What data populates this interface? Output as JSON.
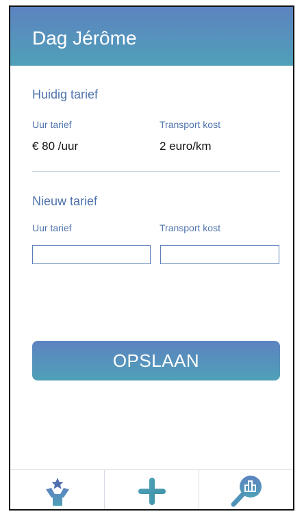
{
  "header": {
    "title": "Dag Jérôme"
  },
  "current": {
    "title": "Huidig tarief",
    "hourly_label": "Uur tarief",
    "hourly_value": "€ 80 /uur",
    "transport_label": "Transport kost",
    "transport_value": "2 euro/km"
  },
  "new": {
    "title": "Nieuw tarief",
    "hourly_label": "Uur tarief",
    "hourly_input_value": "",
    "transport_label": "Transport kost",
    "transport_input_value": ""
  },
  "actions": {
    "save_label": "OPSLAAN"
  },
  "tabbar": {
    "items": [
      {
        "icon": "person-star-icon"
      },
      {
        "icon": "plus-icon"
      },
      {
        "icon": "search-chart-icon"
      }
    ]
  },
  "colors": {
    "accent_blue": "#5d83c0",
    "accent_teal": "#4fa0b8",
    "label_blue": "#4f73ad"
  }
}
